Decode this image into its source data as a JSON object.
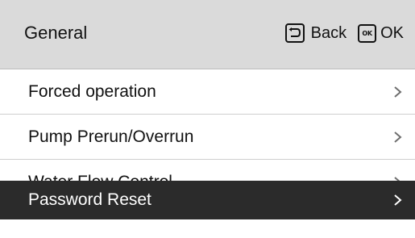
{
  "header": {
    "title": "General",
    "back_label": "Back",
    "ok_icon_text": "OK",
    "ok_label": "OK"
  },
  "menu": {
    "items": [
      {
        "label": "Forced operation",
        "selected": false
      },
      {
        "label": "Pump Prerun/Overrun",
        "selected": false
      },
      {
        "label": "Water Flow Control",
        "selected": false
      },
      {
        "label": "Password Reset",
        "selected": true
      }
    ]
  },
  "colors": {
    "header_bg": "#dadada",
    "selected_bg": "#2b2b2b",
    "selected_text": "#ffffff",
    "text": "#111111",
    "chevron": "#6e6e6e"
  },
  "icons": {
    "back": "back-icon",
    "ok": "ok-icon",
    "row": "chevron-right-icon"
  }
}
